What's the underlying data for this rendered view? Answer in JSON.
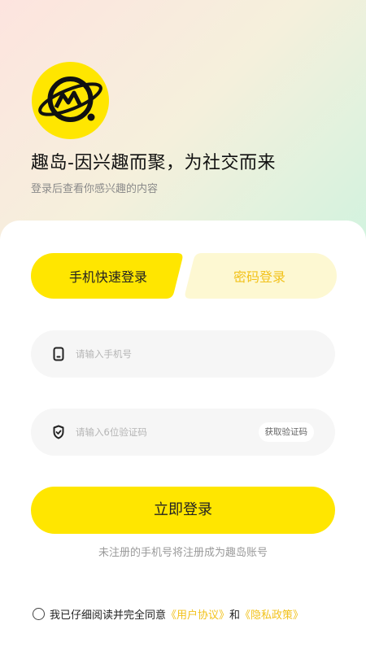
{
  "brand": {
    "logo_name": "planet-logo",
    "headline": "趣岛-因兴趣而聚，为社交而来",
    "subline": "登录后查看你感兴趣的内容"
  },
  "tabs": [
    {
      "label": "手机快速登录",
      "active": true
    },
    {
      "label": "密码登录",
      "active": false
    }
  ],
  "phone": {
    "icon": "phone-icon",
    "placeholder": "请输入手机号"
  },
  "code": {
    "icon": "shield-check-icon",
    "placeholder": "请输入6位验证码",
    "button": "获取验证码"
  },
  "login_button": "立即登录",
  "notice": "未注册的手机号将注册成为趣岛账号",
  "agreement": {
    "checked": false,
    "text": "我已仔细阅读并完全同意",
    "user_agreement": "《用户协议》",
    "and": "和",
    "privacy_policy": "《隐私政策》"
  },
  "colors": {
    "accent": "#ffe600",
    "link": "#f2c21b",
    "tab_inactive_bg": "#fdf8d2"
  }
}
